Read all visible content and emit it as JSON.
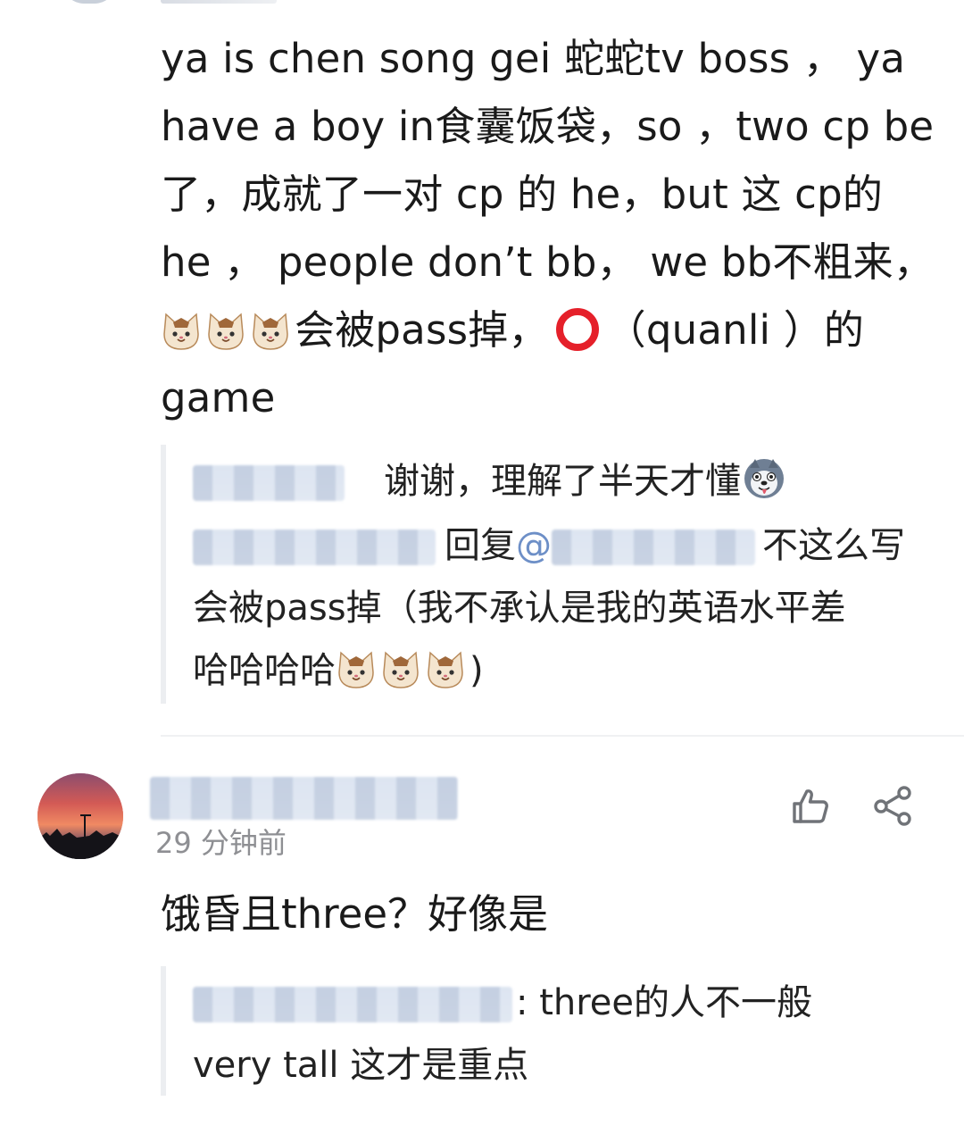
{
  "comment1": {
    "lines": [
      "ya is chen song gei 蛇蛇tv boss ， ya",
      "have a boy in食囊饭袋，so ，two cp be",
      "了，成就了一对 cp 的 he，but 这 cp的",
      "he ， people don’t bb， we bb不粗来，",
      "会被pass掉，",
      "（quanli ）的",
      "game"
    ],
    "icons": [
      "cat-face-emoji",
      "cat-face-emoji",
      "cat-face-emoji",
      "red-circle-emoji"
    ],
    "replies": [
      {
        "text": "谢谢，理解了半天才懂",
        "icon": "husky-dog-emoji"
      },
      {
        "reply_word": "回复",
        "at": "@",
        "text_part1": "不这么写",
        "text_part2": "会被pass掉（我不承认是我的英语水平差",
        "text_part3": "哈哈哈哈",
        "text_end": ")",
        "icons": [
          "cat-face-emoji",
          "cat-face-emoji",
          "cat-face-emoji"
        ]
      }
    ]
  },
  "comment2": {
    "time": "29 分钟前",
    "body": "饿昏且three？好像是",
    "actions": {
      "like_icon": "thumbs-up-icon",
      "share_icon": "share-icon"
    },
    "reply": {
      "line1": ": three的人不一般",
      "line2": "very tall 这才是重点"
    }
  },
  "colors": {
    "text": "#1a1a1a",
    "meta": "#8e8f93",
    "quote_bar": "#eceef1",
    "mention": "#6d8fc7",
    "icon": "#707378"
  }
}
